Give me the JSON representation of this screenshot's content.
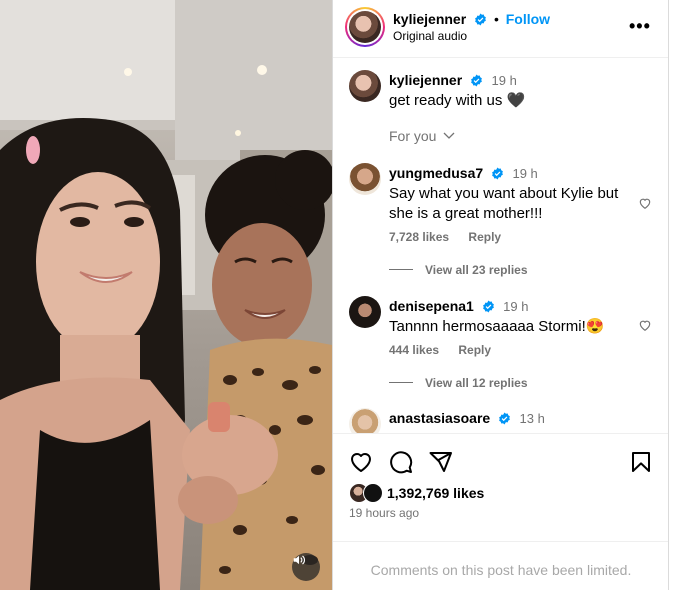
{
  "header": {
    "username": "kyliejenner",
    "separator": "•",
    "follow_label": "Follow",
    "subtitle": "Original audio",
    "more_icon": "more-horizontal-icon"
  },
  "caption": {
    "username": "kyliejenner",
    "time": "19 h",
    "text": "get ready with us 🖤"
  },
  "for_you_label": "For you",
  "comments": [
    {
      "username": "yungmedusa7",
      "time": "19 h",
      "text": "Say what you want about Kylie but she is a great mother!!!",
      "likes": "7,728 likes",
      "reply_label": "Reply",
      "view_replies": "View all 23 replies"
    },
    {
      "username": "denisepena1",
      "time": "19 h",
      "text": "Tannnn hermosaaaaa Stormi!😍",
      "likes": "444 likes",
      "reply_label": "Reply",
      "view_replies": "View all 12 replies"
    },
    {
      "username": "anastasiasoare",
      "time": "13 h",
      "text": "❤️❤️❤️❤️❤️❤️"
    }
  ],
  "actions": {
    "like_icon": "heart-icon",
    "comment_icon": "comment-icon",
    "share_icon": "share-icon",
    "save_icon": "bookmark-icon"
  },
  "likes_count": "1,392,769 likes",
  "posted_ago": "19 hours ago",
  "comments_limited": "Comments on this post have been limited.",
  "colors": {
    "link": "#0095f6",
    "secondary_text": "#737373",
    "verified": "#0095f6"
  }
}
